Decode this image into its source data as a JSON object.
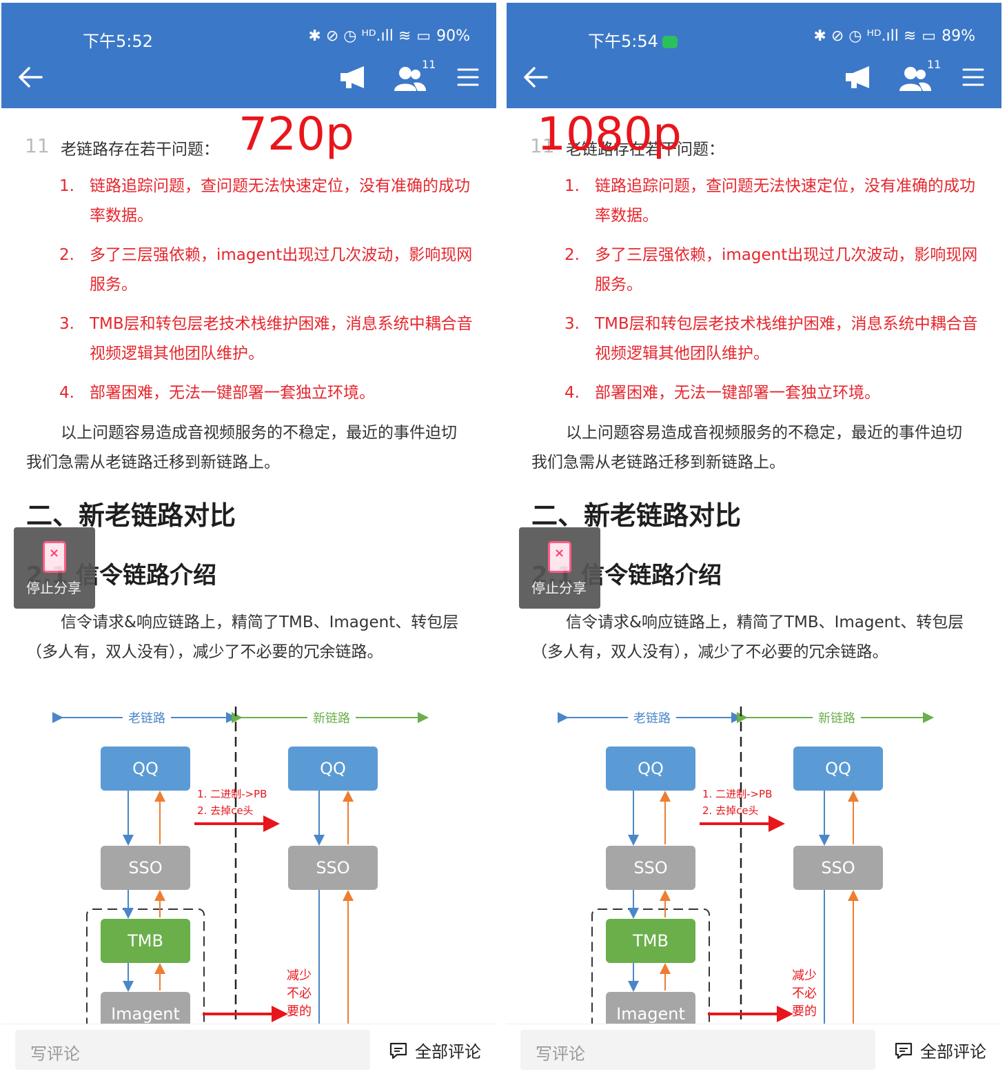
{
  "panels": [
    {
      "status_time": "下午5:52",
      "status_battery": "90%",
      "status_icons": "✱ ⊘ ◷ ᴴᴰ.ıll ≋",
      "overlay_label": "720p",
      "group_count": "11"
    },
    {
      "status_time": "下午5:54",
      "status_battery": "89%",
      "status_icons": "✱ ⊘ ◷ ᴴᴰ.ıll ≋",
      "overlay_label": "1080p",
      "group_count": "11"
    }
  ],
  "article": {
    "para_number": "11",
    "intro": "老链路存在若干问题：",
    "problems": [
      {
        "num": "1.",
        "text": "链路追踪问题，查问题无法快速定位，没有准确的成功率数据。"
      },
      {
        "num": "2.",
        "text": "多了三层强依赖，imagent出现过几次波动，影响现网服务。"
      },
      {
        "num": "3.",
        "text": "TMB层和转包层老技术栈维护困难，消息系统中耦合音视频逻辑其他团队维护。"
      },
      {
        "num": "4.",
        "text": "部署困难，无法一键部署一套独立环境。"
      }
    ],
    "summary": "以上问题容易造成音视频服务的不稳定，最近的事件迫切我们急需从老链路迁移到新链路上。",
    "section_title": "二、新老链路对比",
    "subsection_title": "2.1 信令链路介绍",
    "subsection_text": "信令请求&响应链路上，精简了TMB、Imagent、转包层（多人有，双人没有），减少了不必要的冗余链路。",
    "stop_share": "停止分享"
  },
  "diagram": {
    "old_label": "老链路",
    "new_label": "新链路",
    "boxes": {
      "qq": "QQ",
      "sso": "SSO",
      "tmb": "TMB",
      "imagent": "Imagent"
    },
    "note1": "1. 二进制->PB",
    "note2": "2. 去掉ce头",
    "reduce_note": [
      "减少",
      "不必",
      "要的"
    ],
    "colors": {
      "blue": "#5b9bd5",
      "gray": "#a6a6a6",
      "green": "#6aaf4a",
      "red": "#e8161c",
      "orange": "#ed7d31",
      "line_blue": "#4a86c8"
    }
  },
  "bottom": {
    "comment_placeholder": "写评论",
    "all_comments": "全部评论"
  },
  "colors": {
    "appbar": "#3c78c8",
    "red_text": "#e6262d",
    "overlay_text": "#e8161c"
  }
}
